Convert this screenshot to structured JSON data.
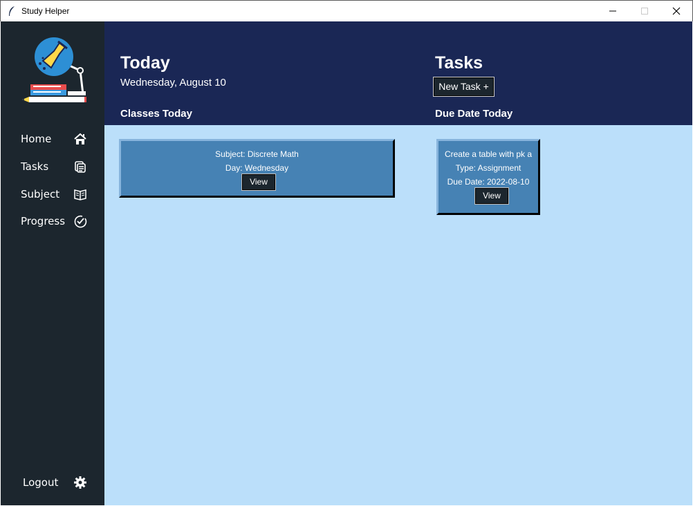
{
  "window": {
    "title": "Study Helper"
  },
  "sidebar": {
    "items": [
      {
        "label": "Home",
        "icon": "home-icon"
      },
      {
        "label": "Tasks",
        "icon": "tasks-icon"
      },
      {
        "label": "Subject",
        "icon": "book-icon"
      },
      {
        "label": "Progress",
        "icon": "check-circle-icon"
      }
    ],
    "logout": {
      "label": "Logout",
      "icon": "gear-icon"
    }
  },
  "header": {
    "today_title": "Today",
    "date": "Wednesday, August 10",
    "classes_heading": "Classes Today",
    "tasks_title": "Tasks",
    "new_task_label": "New Task +",
    "due_heading": "Due Date Today"
  },
  "classes": [
    {
      "subject": "Subject: Discrete Math",
      "day": "Day: Wednesday",
      "view_label": "View"
    }
  ],
  "tasks": [
    {
      "title": "Create a table with pk a",
      "type": "Type: Assignment",
      "due": "Due Date: 2022-08-10",
      "view_label": "View"
    }
  ],
  "colors": {
    "sidebar_bg": "#1c262e",
    "header_bg": "#1a2755",
    "content_bg": "#bbdffa",
    "card_bg": "#4682b4"
  }
}
